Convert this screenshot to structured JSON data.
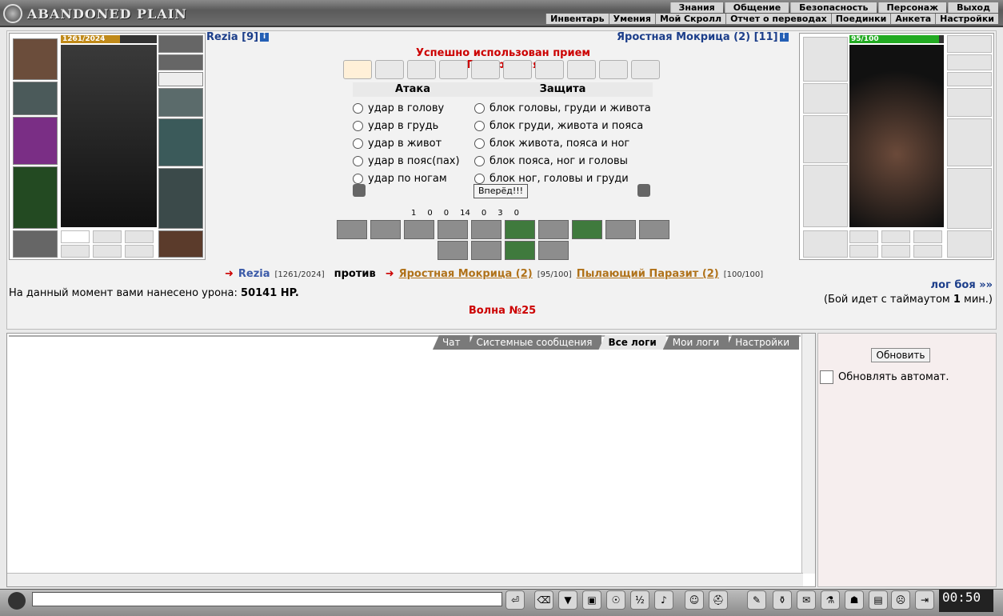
{
  "header": {
    "logo_text": "ABANDONED PLAIN",
    "menu_top": [
      "Знания",
      "Общение",
      "Безопасность",
      "Персонаж",
      "Выход"
    ],
    "menu_sub": [
      "Инвентарь",
      "Умения",
      "Мой Скролл",
      "Отчет о переводах",
      "Поединки",
      "Анкета",
      "Настройки"
    ]
  },
  "player": {
    "name": "Rezia [9]",
    "hp": "1261/2024",
    "hp_pct": 62
  },
  "enemy": {
    "name": "Яростная Мокрица (2) [11]",
    "hp": "95/100",
    "hp_pct": 95
  },
  "battle": {
    "used_msg": "Успешно использован прием \"Прикрыться\"",
    "attack_title": "Атака",
    "defense_title": "Защита",
    "attacks": [
      "удар в голову",
      "удар в грудь",
      "удар в живот",
      "удар в пояс(пах)",
      "удар по ногам"
    ],
    "defenses": [
      "блок головы, груди и живота",
      "блок груди, живота и пояса",
      "блок живота, пояса и ног",
      "блок пояса, ног и головы",
      "блок ног, головы и груди"
    ],
    "go": "Вперёд!!!",
    "stats": [
      "1",
      "0",
      "0",
      "14",
      "0",
      "3",
      "0"
    ]
  },
  "versus": {
    "player": "Rezia",
    "player_hp": "[1261/2024]",
    "vs": "против",
    "enemy1": "Яростная Мокрица (2)",
    "enemy1_hp": "[95/100]",
    "enemy2": "Пылающий Паразит (2)",
    "enemy2_hp": "[100/100]"
  },
  "damage": {
    "label": "На данный момент вами нанесено урона:",
    "value": "50141 HP."
  },
  "wave": "Волна №25",
  "log_link": "лог боя »»",
  "timeout": {
    "pre": "(Бой идет с таймаутом ",
    "num": "1",
    "post": " мин.)"
  },
  "log_tabs": [
    "Чат",
    "Системные сообщения",
    "Все логи",
    "Мои логи",
    "Настройки"
  ],
  "right": {
    "refresh": "Обновить",
    "auto": "Обновлять автомат."
  },
  "clock": "00:50"
}
